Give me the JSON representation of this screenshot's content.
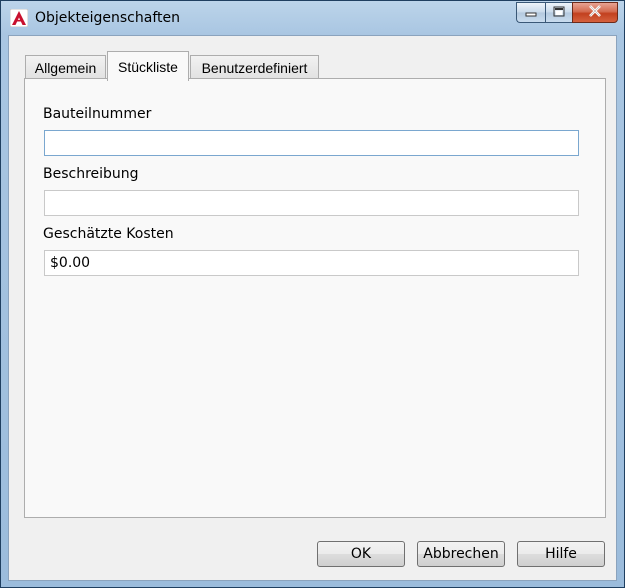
{
  "window": {
    "title": "Objekteigenschaften"
  },
  "tabs": [
    {
      "label": "Allgemein"
    },
    {
      "label": "Stückliste"
    },
    {
      "label": "Benutzerdefiniert"
    }
  ],
  "active_tab": "Stückliste",
  "fields": {
    "part_number": {
      "label": "Bauteilnummer",
      "value": ""
    },
    "description": {
      "label": "Beschreibung",
      "value": ""
    },
    "estimated_cost": {
      "label": "Geschätzte Kosten",
      "value": "$0.00"
    }
  },
  "buttons": {
    "ok": "OK",
    "cancel": "Abbrechen",
    "help": "Hilfe"
  },
  "colors": {
    "app_icon": "#c8102e",
    "close_button": "#c2401f"
  },
  "icons": {
    "app": "autocad-logo-icon",
    "minimize": "minimize-icon",
    "maximize": "maximize-icon",
    "close": "close-icon"
  }
}
